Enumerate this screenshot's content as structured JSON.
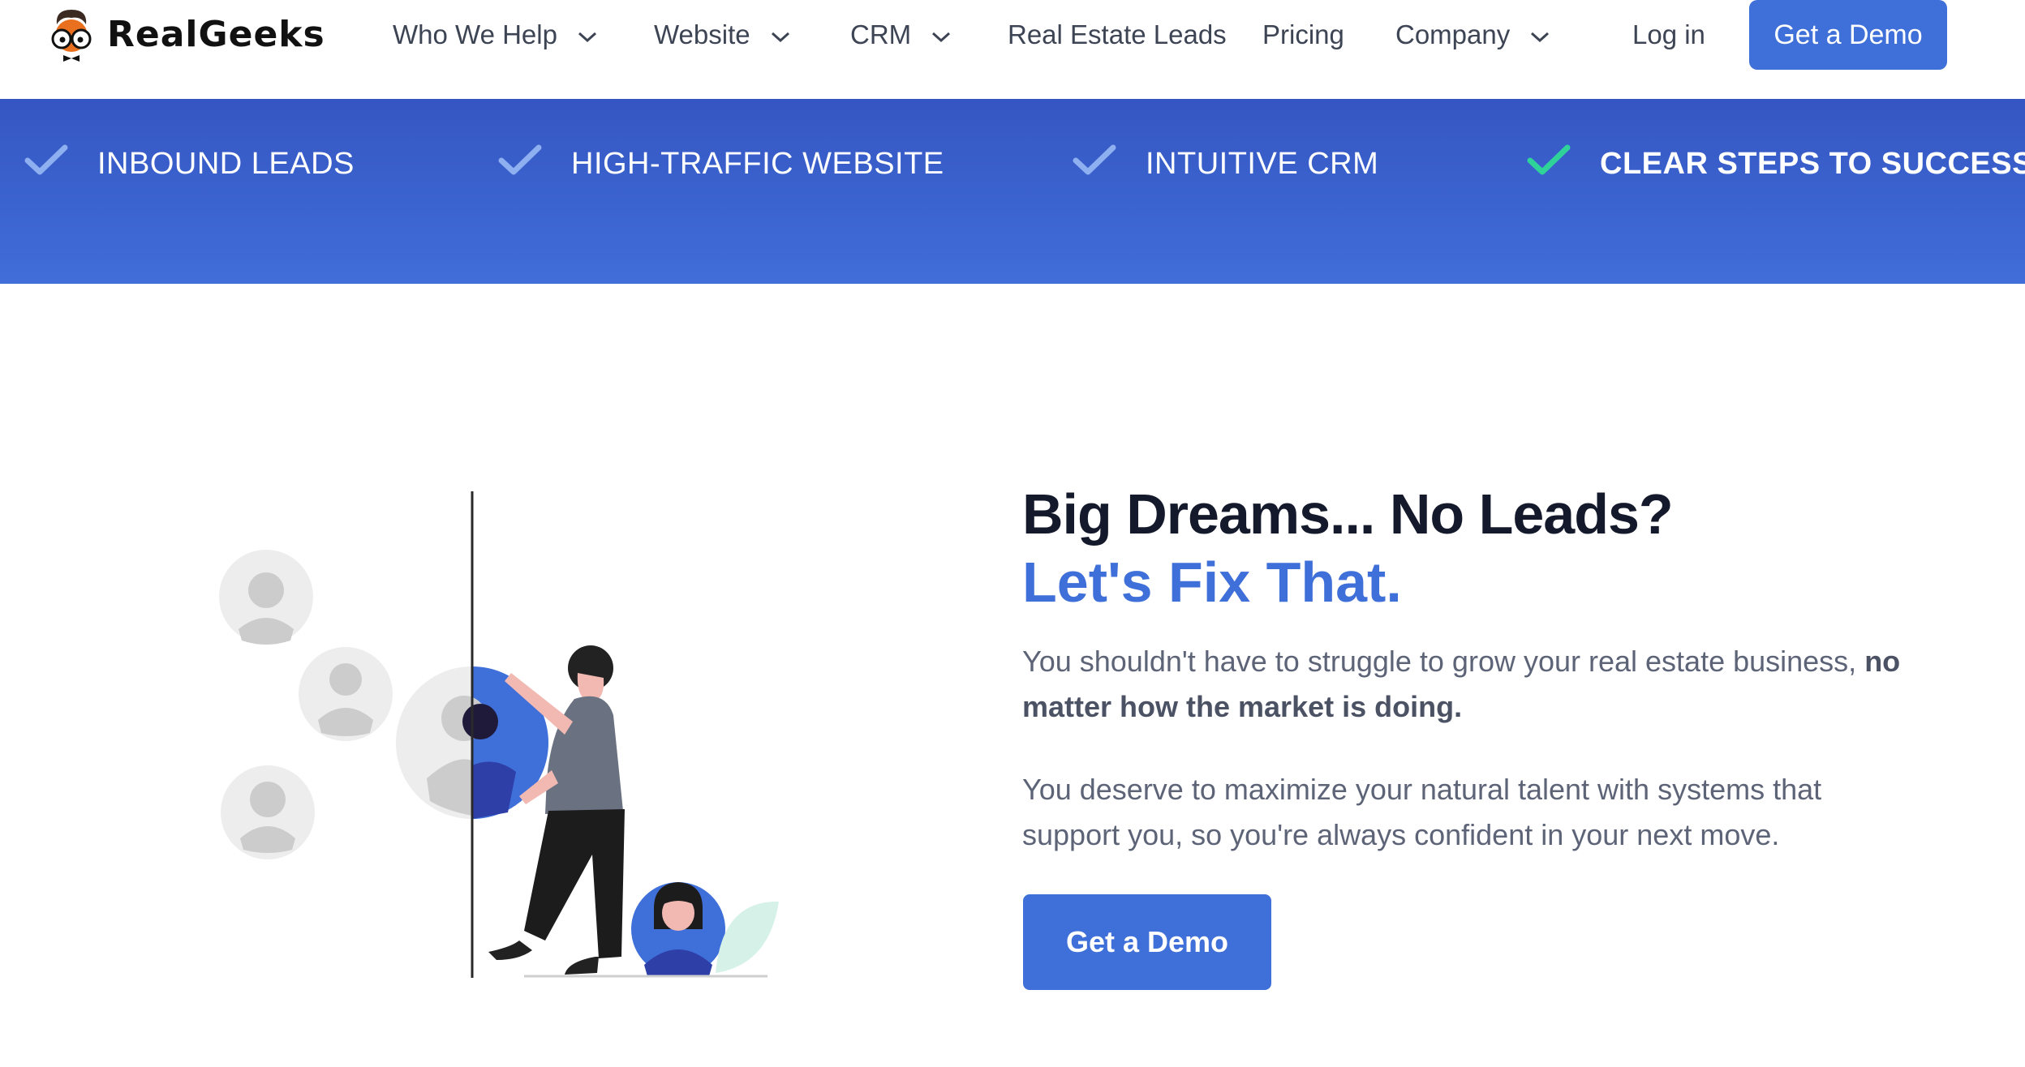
{
  "brand": {
    "name": "RealGeeks"
  },
  "nav": {
    "items": [
      {
        "label": "Who We Help",
        "has_dropdown": true
      },
      {
        "label": "Website",
        "has_dropdown": true
      },
      {
        "label": "CRM",
        "has_dropdown": true
      },
      {
        "label": "Real Estate Leads",
        "has_dropdown": false
      },
      {
        "label": "Pricing",
        "has_dropdown": false
      },
      {
        "label": "Company",
        "has_dropdown": true
      }
    ],
    "login_label": "Log in",
    "demo_label": "Get a Demo"
  },
  "banner": {
    "features": [
      {
        "label": "INBOUND LEADS",
        "active": false
      },
      {
        "label": "HIGH-TRAFFIC WEBSITE",
        "active": false
      },
      {
        "label": "INTUITIVE CRM",
        "active": false
      },
      {
        "label": "CLEAR STEPS TO SUCCESS",
        "active": true
      }
    ]
  },
  "hero": {
    "title": "Big Dreams... No Leads?",
    "subtitle": "Let's Fix That.",
    "paragraph1_text": "You shouldn't have to struggle to grow your real estate business, ",
    "paragraph1_bold": "no matter how the market is doing.",
    "paragraph2": "You deserve to maximize your natural talent with systems that support you, so you're always confident in your next move.",
    "cta_label": "Get a Demo"
  },
  "colors": {
    "brand_blue": "#3f6fd8",
    "banner_dark": "#3556c2",
    "check_inactive": "#8fb0f0",
    "check_active": "#2fd39a",
    "heading": "#14192b",
    "body_text": "#5d6477"
  },
  "icons": {
    "dropdown": "chevron-down-icon",
    "feature_check": "checkmark-icon",
    "logo": "geek-mascot-icon"
  }
}
